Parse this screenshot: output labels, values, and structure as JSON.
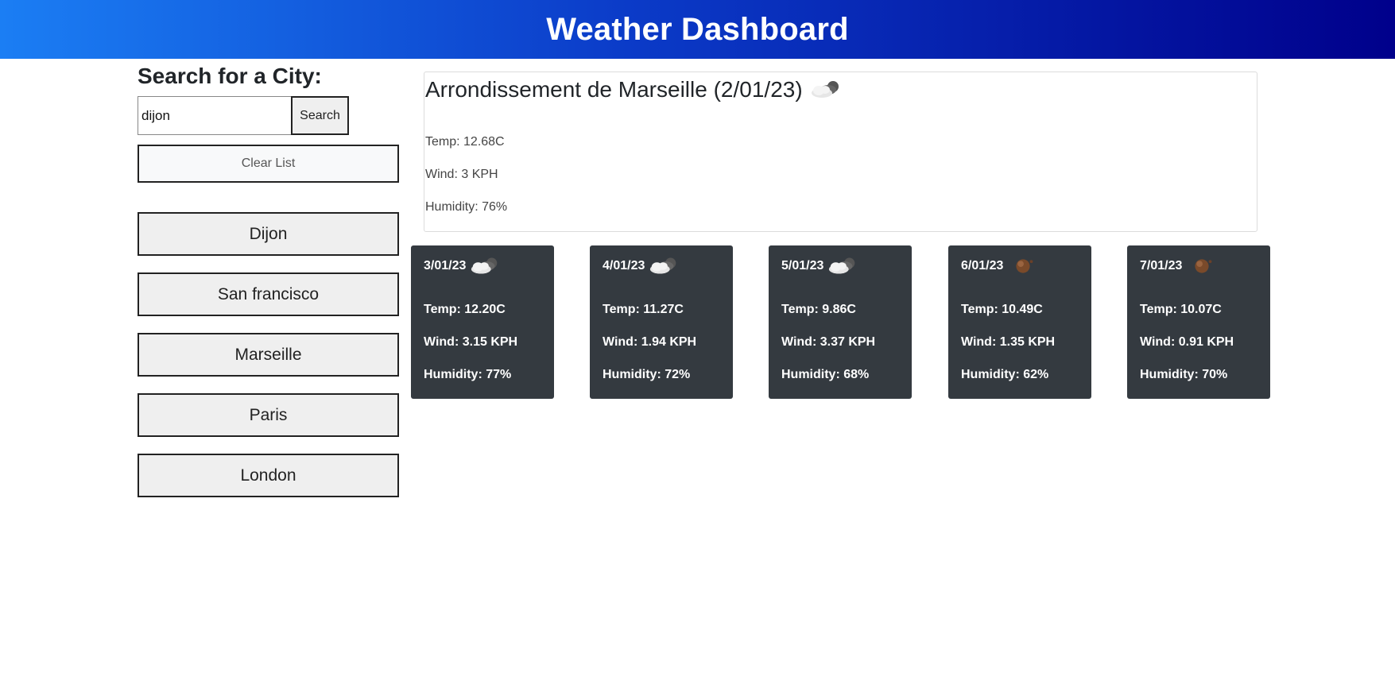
{
  "header": {
    "title": "Weather Dashboard"
  },
  "search": {
    "heading": "Search for a City:",
    "input_value": "dijon",
    "button_label": "Search",
    "clear_label": "Clear List"
  },
  "history": [
    "Dijon",
    "San francisco",
    "Marseille",
    "Paris",
    "London"
  ],
  "current": {
    "title": "Arrondissement de Marseille (2/01/23)",
    "icon": "cloudy-icon",
    "temp": "Temp: 12.68C",
    "wind": "Wind: 3 KPH",
    "humidity": "Humidity: 76%"
  },
  "forecast": [
    {
      "date": "3/01/23",
      "icon": "cloudy-icon",
      "temp": "Temp: 12.20C",
      "wind": "Wind: 3.15 KPH",
      "humidity": "Humidity: 77%"
    },
    {
      "date": "4/01/23",
      "icon": "cloudy-icon",
      "temp": "Temp: 11.27C",
      "wind": "Wind: 1.94 KPH",
      "humidity": "Humidity: 72%"
    },
    {
      "date": "5/01/23",
      "icon": "cloudy-icon",
      "temp": "Temp: 9.86C",
      "wind": "Wind: 3.37 KPH",
      "humidity": "Humidity: 68%"
    },
    {
      "date": "6/01/23",
      "icon": "rain-icon",
      "temp": "Temp: 10.49C",
      "wind": "Wind: 1.35 KPH",
      "humidity": "Humidity: 62%"
    },
    {
      "date": "7/01/23",
      "icon": "rain-icon",
      "temp": "Temp: 10.07C",
      "wind": "Wind: 0.91 KPH",
      "humidity": "Humidity: 70%"
    }
  ]
}
